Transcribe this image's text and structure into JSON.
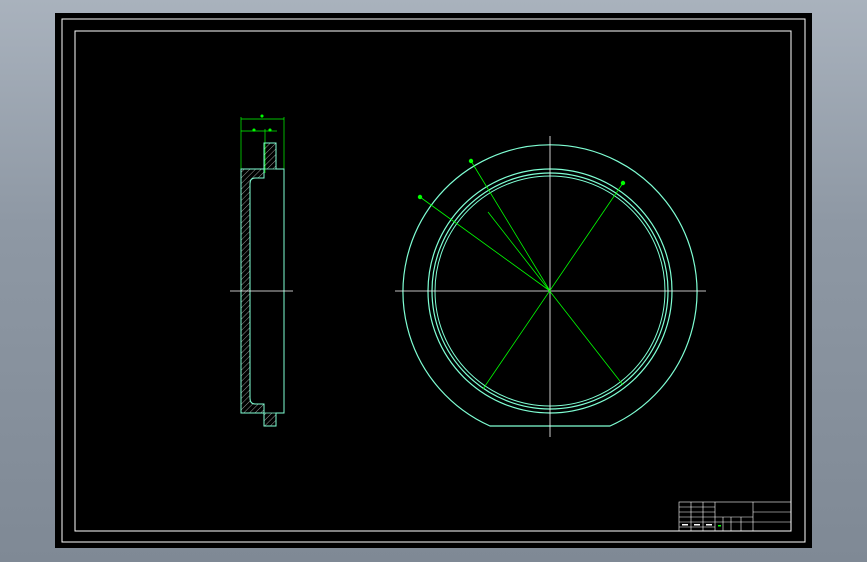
{
  "viewport": {
    "background": "gray gradient",
    "sheet_color": "#000000"
  },
  "colors": {
    "border": "#ffffff",
    "part_outline": "#7fffd4",
    "center_line": "#ffffff",
    "dimension": "#00ff00",
    "hatch": "#ffffff"
  },
  "side_view": {
    "name": "ring-section-view",
    "hatched": true
  },
  "front_view": {
    "name": "ring-front-view",
    "flat_bottom": true
  },
  "title_block": {
    "rows": 6,
    "columns": 5
  }
}
